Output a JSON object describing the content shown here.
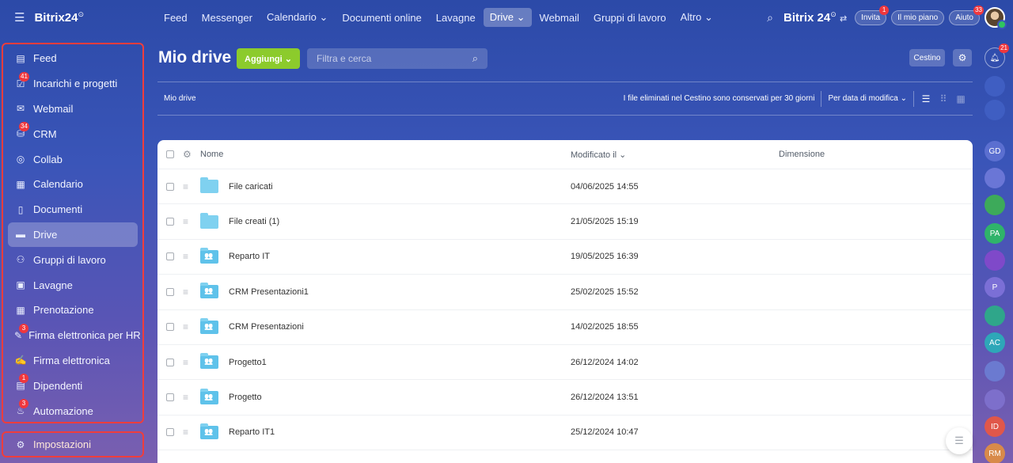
{
  "app": {
    "logo": "Bitrix24",
    "logo_mark": "⊙",
    "brand_right": "Bitrix 24",
    "brand_right_mark": "⊙"
  },
  "topnav": [
    {
      "label": "Feed"
    },
    {
      "label": "Messenger"
    },
    {
      "label": "Calendario ⌄"
    },
    {
      "label": "Documenti online"
    },
    {
      "label": "Lavagne"
    },
    {
      "label": "Drive ⌄",
      "active": true
    },
    {
      "label": "Webmail"
    },
    {
      "label": "Gruppi di lavoro"
    },
    {
      "label": "Altro ⌄"
    }
  ],
  "topright": {
    "invite_label": "Invita",
    "invite_badge": "1",
    "plan_label": "Il mio piano",
    "help_label": "Aiuto",
    "help_badge": "33"
  },
  "sidebar": {
    "items": [
      {
        "label": "Feed",
        "icon": "feed-icon",
        "glyph": "▤"
      },
      {
        "label": "Incarichi e progetti",
        "icon": "tasks-icon",
        "glyph": "☑",
        "badge": "41"
      },
      {
        "label": "Webmail",
        "icon": "mail-icon",
        "glyph": "✉"
      },
      {
        "label": "CRM",
        "icon": "crm-icon",
        "glyph": "⛁",
        "badge": "34"
      },
      {
        "label": "Collab",
        "icon": "collab-icon",
        "glyph": "◎"
      },
      {
        "label": "Calendario",
        "icon": "calendar-icon",
        "glyph": "▦"
      },
      {
        "label": "Documenti",
        "icon": "document-icon",
        "glyph": "▯"
      },
      {
        "label": "Drive",
        "icon": "drive-icon",
        "glyph": "▬",
        "active": true
      },
      {
        "label": "Gruppi di lavoro",
        "icon": "group-icon",
        "glyph": "⚇"
      },
      {
        "label": "Lavagne",
        "icon": "board-icon",
        "glyph": "▣"
      },
      {
        "label": "Prenotazione",
        "icon": "booking-icon",
        "glyph": "▦"
      },
      {
        "label": "Firma elettronica per HR",
        "icon": "hr-sign-icon",
        "glyph": "✎",
        "badge": "3"
      },
      {
        "label": "Firma elettronica",
        "icon": "sign-icon",
        "glyph": "✍"
      },
      {
        "label": "Dipendenti",
        "icon": "employees-icon",
        "glyph": "▤",
        "badge": "1"
      },
      {
        "label": "Automazione",
        "icon": "automation-icon",
        "glyph": "♨",
        "badge": "3"
      }
    ],
    "settings_label": "Impostazioni"
  },
  "main": {
    "title": "Mio drive",
    "add_label": "Aggiungi ⌄",
    "search_placeholder": "Filtra e cerca",
    "trash_label": "Cestino",
    "breadcrumb": "Mio drive",
    "retention_note": "I file eliminati nel Cestino sono conservati per 30 giorni",
    "sort_label": "Per data di modifica ⌄"
  },
  "table": {
    "headers": {
      "name": "Nome",
      "modified": "Modificato il ⌄",
      "size": "Dimensione"
    },
    "rows": [
      {
        "name": "File caricati",
        "modified": "04/06/2025 14:55",
        "size": "",
        "shared": false
      },
      {
        "name": "File creati (1)",
        "modified": "21/05/2025 15:19",
        "size": "",
        "shared": false
      },
      {
        "name": "Reparto IT",
        "modified": "19/05/2025 16:39",
        "size": "",
        "shared": true
      },
      {
        "name": "CRM Presentazioni1",
        "modified": "25/02/2025 15:52",
        "size": "",
        "shared": true
      },
      {
        "name": "CRM Presentazioni",
        "modified": "14/02/2025 18:55",
        "size": "",
        "shared": true
      },
      {
        "name": "Progetto1",
        "modified": "26/12/2024 14:02",
        "size": "",
        "shared": true
      },
      {
        "name": "Progetto",
        "modified": "26/12/2024 13:51",
        "size": "",
        "shared": true
      },
      {
        "name": "Reparto IT1",
        "modified": "25/12/2024 10:47",
        "size": "",
        "shared": true
      }
    ]
  },
  "rail": {
    "notifications_badge": "21",
    "items": [
      {
        "text": "",
        "icon": "bell-icon",
        "color": "#3f5ec2"
      },
      {
        "text": "",
        "icon": "copilot-icon",
        "color": "#3f5ec2"
      },
      {
        "text": "",
        "icon": "chat-icon",
        "color": "#3f5ec2"
      },
      {
        "text": "GD",
        "icon": "avatar-gd",
        "color": "#5b6fd0"
      },
      {
        "text": "",
        "icon": "group-avatar-icon",
        "color": "#6a76d6"
      },
      {
        "text": "",
        "icon": "group-green-icon",
        "color": "#3daa5a"
      },
      {
        "text": "PA",
        "icon": "avatar-pa",
        "color": "#2fb36a"
      },
      {
        "text": "",
        "icon": "copilot-chat-icon",
        "color": "#7f49c9"
      },
      {
        "text": "P",
        "icon": "avatar-p",
        "color": "#7b6fd6"
      },
      {
        "text": "",
        "icon": "task-chat-icon",
        "color": "#2fa68a"
      },
      {
        "text": "AC",
        "icon": "avatar-ac",
        "color": "#2ea7b8"
      },
      {
        "text": "",
        "icon": "video-icon",
        "color": "#6b7ad0"
      },
      {
        "text": "",
        "icon": "video-icon-2",
        "color": "#7d6fcb"
      },
      {
        "text": "ID",
        "icon": "avatar-id",
        "color": "#e0574a"
      },
      {
        "text": "RM",
        "icon": "avatar-rm",
        "color": "#d88a4a"
      }
    ]
  }
}
